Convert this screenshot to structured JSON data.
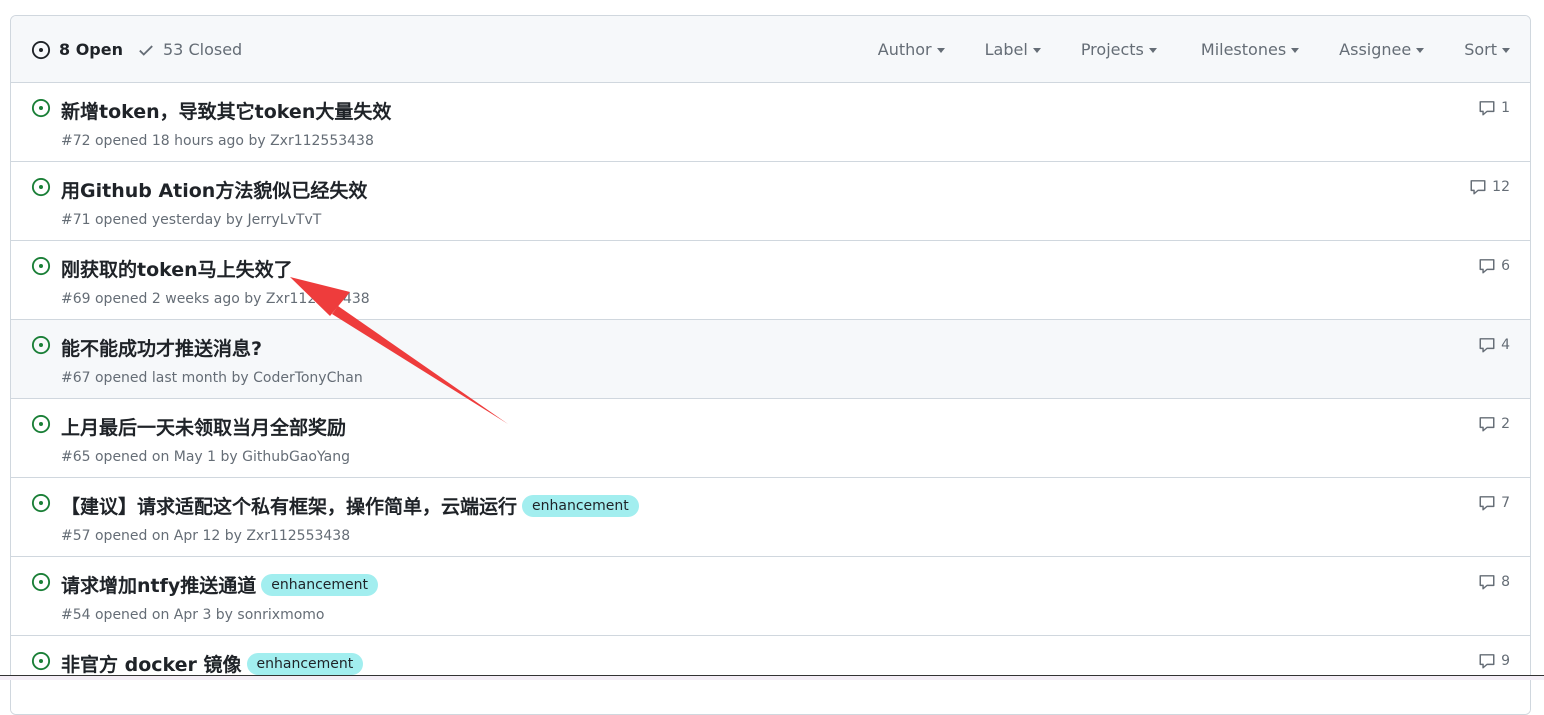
{
  "header": {
    "open_count": "8 Open",
    "closed_count": "53 Closed",
    "filters": [
      "Author",
      "Label",
      "Projects",
      "Milestones",
      "Assignee",
      "Sort"
    ]
  },
  "issues": [
    {
      "title": "新增token，导致其它token大量失效",
      "meta": "#72 opened 18 hours ago by Zxr112553438",
      "comments": "1",
      "label": ""
    },
    {
      "title": "用Github Ation方法貌似已经失效",
      "meta": "#71 opened yesterday by JerryLvTvT",
      "comments": "12",
      "label": ""
    },
    {
      "title": "刚获取的token马上失效了",
      "meta": "#69 opened 2 weeks ago by Zxr112553438",
      "comments": "6",
      "label": ""
    },
    {
      "title": "能不能成功才推送消息?",
      "meta": "#67 opened last month by CoderTonyChan",
      "comments": "4",
      "label": ""
    },
    {
      "title": "上月最后一天未领取当月全部奖励",
      "meta": "#65 opened on May 1 by GithubGaoYang",
      "comments": "2",
      "label": ""
    },
    {
      "title": "【建议】请求适配这个私有框架，操作简单，云端运行",
      "meta": "#57 opened on Apr 12 by Zxr112553438",
      "comments": "7",
      "label": "enhancement"
    },
    {
      "title": "请求增加ntfy推送通道",
      "meta": "#54 opened on Apr 3 by sonrixmomo",
      "comments": "8",
      "label": "enhancement"
    },
    {
      "title": "非官方 docker 镜像",
      "meta": "",
      "comments": "9",
      "label": "enhancement"
    }
  ],
  "colors": {
    "open_green": "#1a7f37",
    "label_enhancement": "#a2eeef",
    "annotation_arrow": "#ee3c3c"
  }
}
